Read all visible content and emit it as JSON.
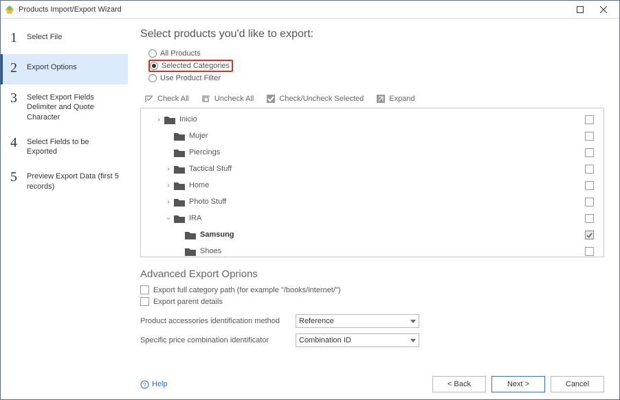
{
  "window": {
    "title": "Products Import/Export Wizard"
  },
  "steps": {
    "1": "Select File",
    "2": "Export Options",
    "3": "Select Export Fields Delimiter and Quote Character",
    "4": "Select Fields to be Exported",
    "5": "Preview Export Data (first 5 records)"
  },
  "heading": "Select products you'd like to export:",
  "radios": {
    "all": "All Products",
    "selected": "Selected Categories",
    "filter": "Use Product Filter"
  },
  "toolbar": {
    "check_all": "Check All",
    "uncheck_all": "Uncheck All",
    "check_selected": "Check/Uncheck Selected",
    "expand": "Expand"
  },
  "tree": {
    "inicio": "Inicio",
    "mujer": "Mujer",
    "piercings": "Piercings",
    "tactical": "Tactical Stuff",
    "home": "Home",
    "photo": "Photo Stuff",
    "ira": "IRA",
    "samsung": "Samsung",
    "shoes": "Shoes"
  },
  "advanced": {
    "heading": "Advanced Export Oprions",
    "full_path_label": "Export full category path (for example \"/books/internet/\")",
    "parent_details_label": "Export parent details",
    "accessory_method_label": "Product accessories identification method",
    "accessory_method_value": "Reference",
    "price_combo_label": "Specific price combination identificator",
    "price_combo_value": "Combination ID"
  },
  "footer": {
    "help": "Help",
    "back": "< Back",
    "next": "Next >",
    "cancel": "Cancel"
  }
}
